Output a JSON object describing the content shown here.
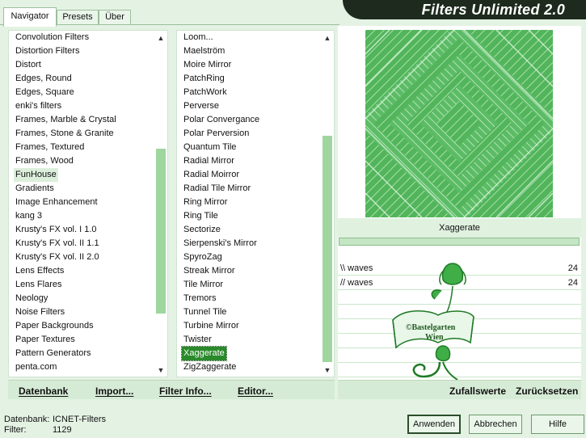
{
  "tabs": [
    {
      "label": "Navigator",
      "active": true
    },
    {
      "label": "Presets",
      "active": false
    },
    {
      "label": "Über",
      "active": false
    }
  ],
  "title": "Filters Unlimited 2.0",
  "categories": [
    "Convolution Filters",
    "Distortion Filters",
    "Distort",
    "Edges, Round",
    "Edges, Square",
    "enki's filters",
    "Frames, Marble & Crystal",
    "Frames, Stone & Granite",
    "Frames, Textured",
    "Frames, Wood",
    "FunHouse",
    "Gradients",
    "Image Enhancement",
    "kang 3",
    "Krusty's FX vol. I 1.0",
    "Krusty's FX vol. II 1.1",
    "Krusty's FX vol. II 2.0",
    "Lens Effects",
    "Lens Flares",
    "Neology",
    "Noise Filters",
    "Paper Backgrounds",
    "Paper Textures",
    "Pattern Generators",
    "penta.com"
  ],
  "category_selected": "FunHouse",
  "filters": [
    "Loom...",
    "Maelström",
    "Moire Mirror",
    "PatchRing",
    "PatchWork",
    "Perverse",
    "Polar Convergance",
    "Polar Perversion",
    "Quantum Tile",
    "Radial Mirror",
    "Radial Moirror",
    "Radial Tile Mirror",
    "Ring Mirror",
    "Ring Tile",
    "Sectorize",
    "Sierpenski's Mirror",
    "SpyroZag",
    "Streak Mirror",
    "Tile Mirror",
    "Tremors",
    "Tunnel Tile",
    "Turbine Mirror",
    "Twister",
    "Xaggerate",
    "ZigZaggerate"
  ],
  "filter_selected": "Xaggerate",
  "left_toolbar": [
    "Datenbank",
    "Import...",
    "Filter Info...",
    "Editor..."
  ],
  "right_toolbar": [
    "Zufallswerte",
    "Zurücksetzen"
  ],
  "preview_caption": "Xaggerate",
  "params": [
    {
      "name": "\\\\ waves",
      "value": "24"
    },
    {
      "name": "// waves",
      "value": "24"
    }
  ],
  "watermark": {
    "line1": "©Bastelgarten",
    "line2": "Wien"
  },
  "status": {
    "db_label": "Datenbank:",
    "db_value": "ICNET-Filters",
    "filter_label": "Filter:",
    "filter_value": "1129"
  },
  "buttons": {
    "apply": "Anwenden",
    "cancel": "Abbrechen",
    "help": "Hilfe"
  },
  "colors": {
    "accent": "#2a8a2a",
    "background": "#e4f2e4",
    "thumb": "#9fd69f"
  }
}
